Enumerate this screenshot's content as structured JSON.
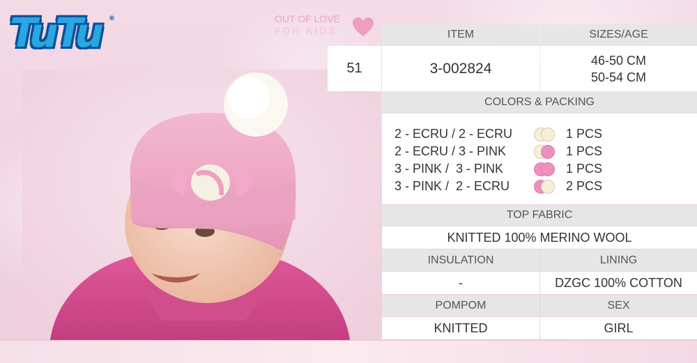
{
  "brand": {
    "logo_text": "TuTu",
    "registered": "®"
  },
  "tagline": {
    "line1": "OUT OF LOVE",
    "line2": "FOR KIDS"
  },
  "table": {
    "number": "51",
    "item_header": "ITEM",
    "item_value": "3-002824",
    "sizes_header": "SIZES/AGE",
    "sizes": [
      "46-50 CM",
      "50-54 CM"
    ],
    "colors_header": "COLORS & PACKING",
    "colors": [
      {
        "label": "2 - ECRU / 2 - ECRU",
        "qty": "1 PCS",
        "dot1": "#f7efd8",
        "dot2": "#f7efd8"
      },
      {
        "label": "2 - ECRU / 3 - PINK",
        "qty": "1 PCS",
        "dot1": "#f7efd8",
        "dot2": "#ee8fbe"
      },
      {
        "label": "3 - PINK /  3 - PINK",
        "qty": "1 PCS",
        "dot1": "#ee8fbe",
        "dot2": "#ee8fbe"
      },
      {
        "label": "3 - PINK /  2 - ECRU",
        "qty": "2 PCS",
        "dot1": "#ee8fbe",
        "dot2": "#f7efd8"
      }
    ],
    "top_fabric_header": "TOP FABRIC",
    "top_fabric_value": "KNITTED 100% MERINO WOOL",
    "insulation_header": "INSULATION",
    "insulation_value": "-",
    "lining_header": "LINING",
    "lining_value": "DZGC 100% COTTON",
    "pompom_header": "POMPOM",
    "pompom_value": "KNITTED",
    "sex_header": "SEX",
    "sex_value": "GIRL"
  },
  "colors": {
    "brand_blue": "#2aa6e0",
    "brand_dark": "#0b4f9a",
    "pink": "#ee8fbe",
    "ecru": "#f7efd8",
    "header_gray": "#e6e6e6"
  }
}
